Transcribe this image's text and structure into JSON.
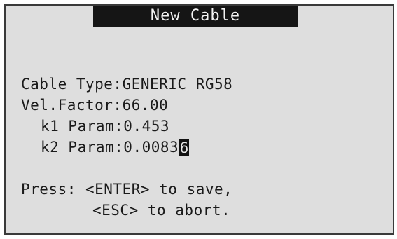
{
  "window": {
    "title": "New Cable"
  },
  "fields": {
    "cable_type_label": "Cable Type:",
    "cable_type_value": "GENERIC RG58",
    "vel_factor_label": "Vel.Factor:",
    "vel_factor_value": "66.00",
    "k1_label": "k1 Param:",
    "k1_value": "0.453",
    "k2_label": "k2 Param:",
    "k2_value": "0.0083",
    "cursor_char": "6"
  },
  "instructions": {
    "line1": "Press: <ENTER> to save,",
    "line2": "<ESC> to abort."
  }
}
